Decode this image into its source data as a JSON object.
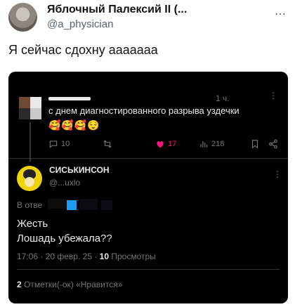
{
  "tweet": {
    "author_name": "Яблочный Палексий II (...",
    "author_handle": "@a_physician",
    "more_label": "⋯",
    "text": "Я сейчас сдохну ааааааа"
  },
  "screenshot": {
    "reply": {
      "time": "1 ч.",
      "more_label": "⋮",
      "text": "с днем диагностированного разрыва уздечки",
      "emojis": "🥰🥰🥰😌",
      "actions": {
        "replies": "10",
        "likes": "17",
        "views": "218"
      }
    },
    "main": {
      "name": "СИСЬКИНСОН",
      "handle": "@...uxlo",
      "more_label": "⋮",
      "reply_to_label": "В отве",
      "text_line1": "Жесть",
      "text_line2": "Лошадь убежала??",
      "timestamp": "17:06 · 20 февр. 25 · ",
      "views_count": "10",
      "views_label": " Просмотры",
      "likes_count": "2",
      "likes_label": " Отметки(-ок) «Нравится»"
    }
  },
  "colors": {
    "like_pink": "#f91880",
    "muted_gray": "#71767b",
    "blue_accent": "#1d9bf0"
  }
}
